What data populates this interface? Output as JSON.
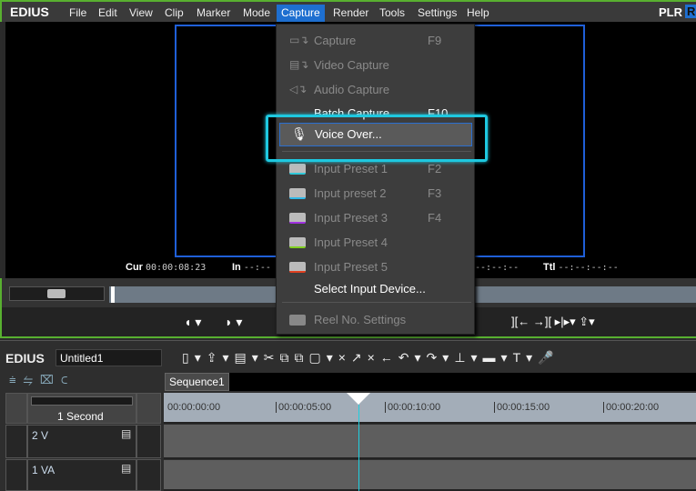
{
  "app": {
    "brand": "EDIUS",
    "plr": "PLR",
    "rec": "RE"
  },
  "menubar": [
    "File",
    "Edit",
    "View",
    "Clip",
    "Marker",
    "Mode",
    "Capture",
    "Render",
    "Tools",
    "Settings",
    "Help"
  ],
  "capture_menu": {
    "items": [
      {
        "label": "Capture",
        "shortcut": "F9",
        "icon": "capture-icon",
        "enabled": false
      },
      {
        "label": "Video Capture",
        "shortcut": "",
        "icon": "video-capture-icon",
        "enabled": false
      },
      {
        "label": "Audio Capture",
        "shortcut": "",
        "icon": "audio-capture-icon",
        "enabled": false
      },
      {
        "label": "Batch Capture",
        "shortcut": "F10",
        "icon": "",
        "enabled": true
      },
      {
        "label": "Voice Over...",
        "shortcut": "",
        "icon": "microphone-icon",
        "enabled": true,
        "highlighted": true
      },
      {
        "label": "Input Preset 1",
        "shortcut": "F2",
        "icon": "preset-icon",
        "color": "#30c8d8",
        "enabled": false
      },
      {
        "label": "Input preset 2",
        "shortcut": "F3",
        "icon": "preset-icon",
        "color": "#30b8e8",
        "enabled": false
      },
      {
        "label": "Input Preset 3",
        "shortcut": "F4",
        "icon": "preset-icon",
        "color": "#a030e0",
        "enabled": false
      },
      {
        "label": "Input Preset 4",
        "shortcut": "",
        "icon": "preset-icon",
        "color": "#80d020",
        "enabled": false
      },
      {
        "label": "Input Preset 5",
        "shortcut": "",
        "icon": "preset-icon",
        "color": "#e04020",
        "enabled": false
      },
      {
        "label": "Select Input Device...",
        "shortcut": "",
        "icon": "",
        "enabled": true
      },
      {
        "label": "Reel No. Settings",
        "shortcut": "",
        "icon": "reel-icon",
        "enabled": false
      }
    ]
  },
  "preview": {
    "cur_label": "Cur",
    "cur": "00:00:08:23",
    "in_label": "In",
    "in": "--:--",
    "out": "--:--:--",
    "ttl_label": "Ttl",
    "ttl": "--:--:--:--"
  },
  "timeline": {
    "brand": "EDIUS",
    "project": "Untitled1",
    "sequence_tab": "Sequence1",
    "scale": "1 Second",
    "ruler": [
      "00:00:00:00",
      "00:00:05:00",
      "00:00:10:00",
      "00:00:15:00",
      "00:00:20:00"
    ],
    "tracks": [
      "2 V",
      "1 VA"
    ]
  },
  "colors": {
    "highlight": "#1ec8e0",
    "accent": "#1e6fd0",
    "window_border": "#58b030"
  }
}
